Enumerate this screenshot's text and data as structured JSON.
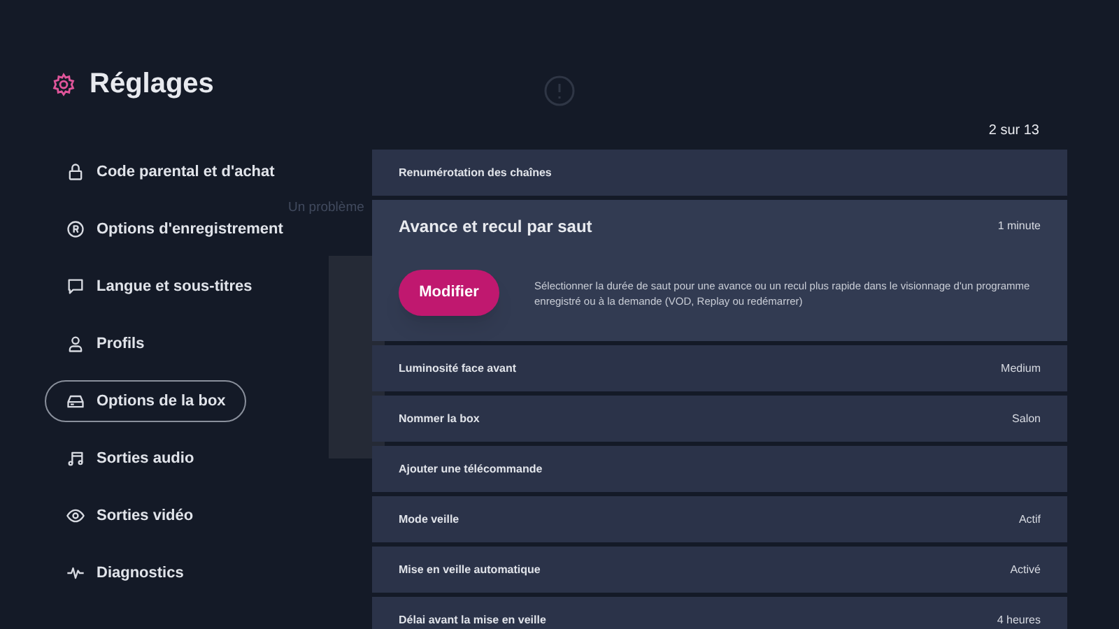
{
  "sidebar": {
    "title": "Réglages",
    "items": [
      {
        "label": "Code parental et d'achat",
        "selected": false
      },
      {
        "label": "Options d'enregistrement",
        "selected": false
      },
      {
        "label": "Langue et sous-titres",
        "selected": false
      },
      {
        "label": "Profils",
        "selected": false
      },
      {
        "label": "Options de la box",
        "selected": true
      },
      {
        "label": "Sorties audio",
        "selected": false
      },
      {
        "label": "Sorties vidéo",
        "selected": false
      },
      {
        "label": "Diagnostics",
        "selected": false
      }
    ]
  },
  "background_dialog": {
    "message": "Un problème"
  },
  "panel": {
    "counter": "2 sur 13",
    "rows": [
      {
        "label": "Renumérotation des chaînes",
        "expanded": false
      },
      {
        "label": "Avance et recul par saut",
        "value": "1 minute",
        "expanded": true,
        "button": "Modifier",
        "description": "Sélectionner la durée de saut pour une avance ou un recul plus rapide dans le visionnage d'un programme enregistré ou à la demande (VOD, Replay ou redémarrer)"
      },
      {
        "label": "Luminosité face avant",
        "value": "Medium",
        "expanded": false
      },
      {
        "label": "Nommer la box",
        "value": "Salon",
        "expanded": false
      },
      {
        "label": "Ajouter une télécommande",
        "expanded": false
      },
      {
        "label": "Mode veille",
        "value": "Actif",
        "expanded": false
      },
      {
        "label": "Mise en veille automatique",
        "value": "Activé",
        "expanded": false
      },
      {
        "label": "Délai avant la mise en veille",
        "value": "4 heures",
        "expanded": false
      }
    ]
  }
}
